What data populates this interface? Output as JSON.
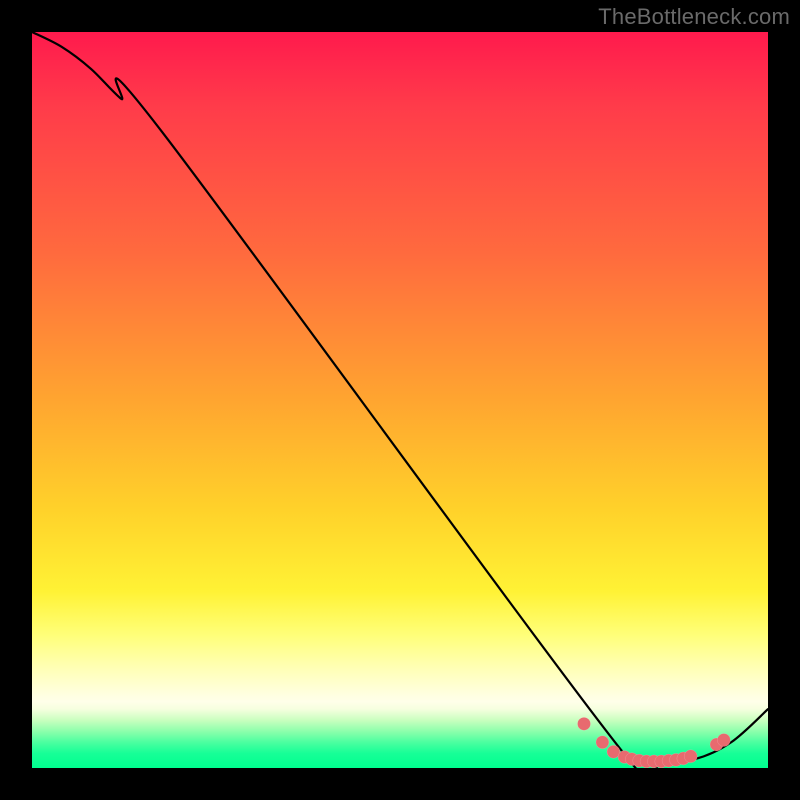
{
  "watermark": "TheBottleneck.com",
  "chart_data": {
    "type": "line",
    "title": "",
    "xlabel": "",
    "ylabel": "",
    "xlim": [
      0,
      100
    ],
    "ylim": [
      0,
      100
    ],
    "series": [
      {
        "name": "bottleneck-curve",
        "x": [
          0,
          4,
          8,
          12,
          18,
          80,
          85,
          90,
          95,
          100
        ],
        "y": [
          100,
          98,
          95,
          91,
          86,
          2.5,
          1.0,
          1.2,
          3.5,
          8
        ]
      }
    ],
    "highlight_points": {
      "name": "optimal-range-dots",
      "x": [
        75,
        77.5,
        79,
        80.5,
        81.5,
        82.5,
        83.5,
        84.5,
        85.5,
        86.5,
        87.5,
        88.5,
        89.5,
        93,
        94
      ],
      "y": [
        6.0,
        3.5,
        2.2,
        1.5,
        1.2,
        1.0,
        0.9,
        0.9,
        0.9,
        1.0,
        1.1,
        1.3,
        1.6,
        3.2,
        3.8
      ]
    },
    "gradient_stops": [
      {
        "pos": 0,
        "color": "#ff1a4d"
      },
      {
        "pos": 50,
        "color": "#ffa530"
      },
      {
        "pos": 80,
        "color": "#ffff7a"
      },
      {
        "pos": 100,
        "color": "#00ff8f"
      }
    ]
  }
}
